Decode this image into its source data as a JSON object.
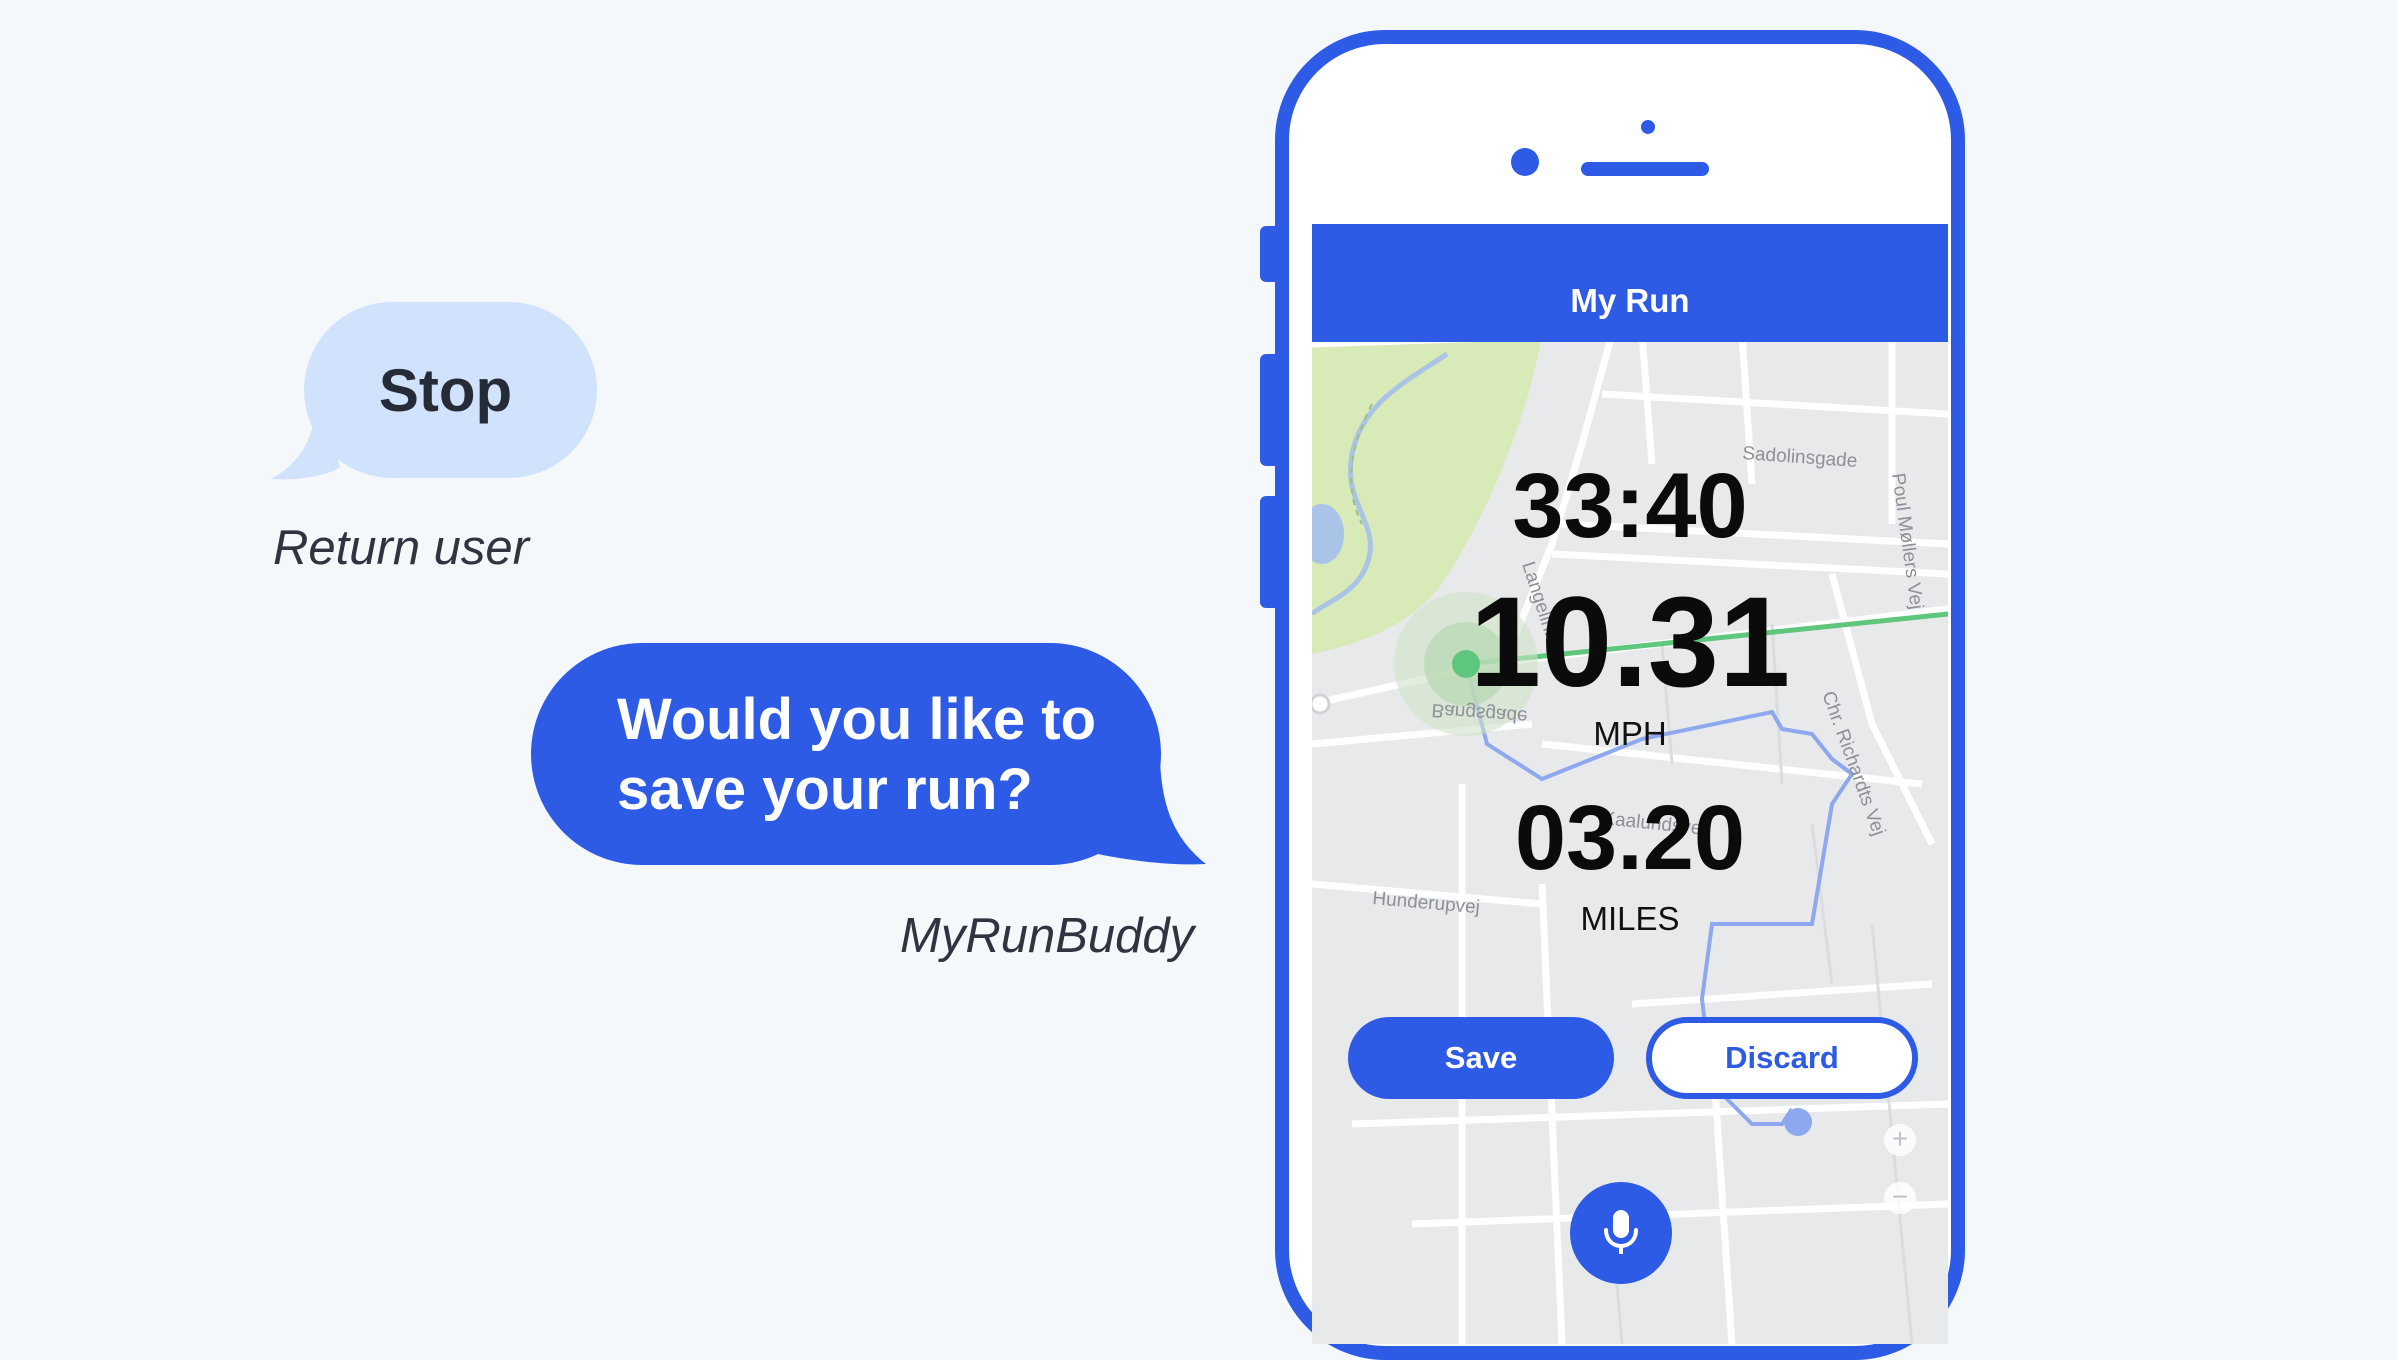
{
  "conversation": {
    "user_message": "Stop",
    "user_caption": "Return user",
    "bot_message_line1": "Would you like to",
    "bot_message_line2": "save your run?",
    "bot_caption": "MyRunBuddy"
  },
  "app": {
    "title": "My Run",
    "time": "33:40",
    "speed": "10.31",
    "speed_unit": "MPH",
    "distance": "03.20",
    "distance_unit": "MILES",
    "save_label": "Save",
    "discard_label": "Discard",
    "zoom_in": "+",
    "zoom_out": "−"
  },
  "map": {
    "street_labels": [
      "Sadolinsgade",
      "Poul Møllers Vej",
      "Langeliniе",
      "Chr. Richardts Vej",
      "Kaalundsvej",
      "Hunderupvej",
      "Bangsgade"
    ]
  },
  "colors": {
    "accent": "#2e5be6",
    "user_bubble": "#d0e2fc",
    "background": "#f5f8fb"
  },
  "icons": {
    "mic": "microphone-icon"
  }
}
